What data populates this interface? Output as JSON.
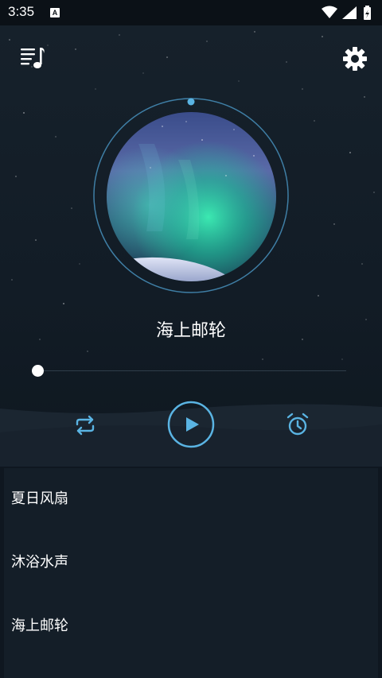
{
  "status": {
    "time": "3:35",
    "notification_letter": "A"
  },
  "player": {
    "now_playing": "海上邮轮",
    "progress": 0.02
  },
  "icons": {
    "playlist": "playlist-music-icon",
    "settings": "gear-icon",
    "repeat": "repeat-icon",
    "play": "play-icon",
    "timer": "alarm-clock-icon"
  },
  "colors": {
    "accent": "#5ab4e3",
    "background": "#0f1720",
    "list_background": "#141e28"
  },
  "tracks": [
    {
      "title": "夏日风扇"
    },
    {
      "title": "沐浴水声"
    },
    {
      "title": "海上邮轮"
    }
  ]
}
